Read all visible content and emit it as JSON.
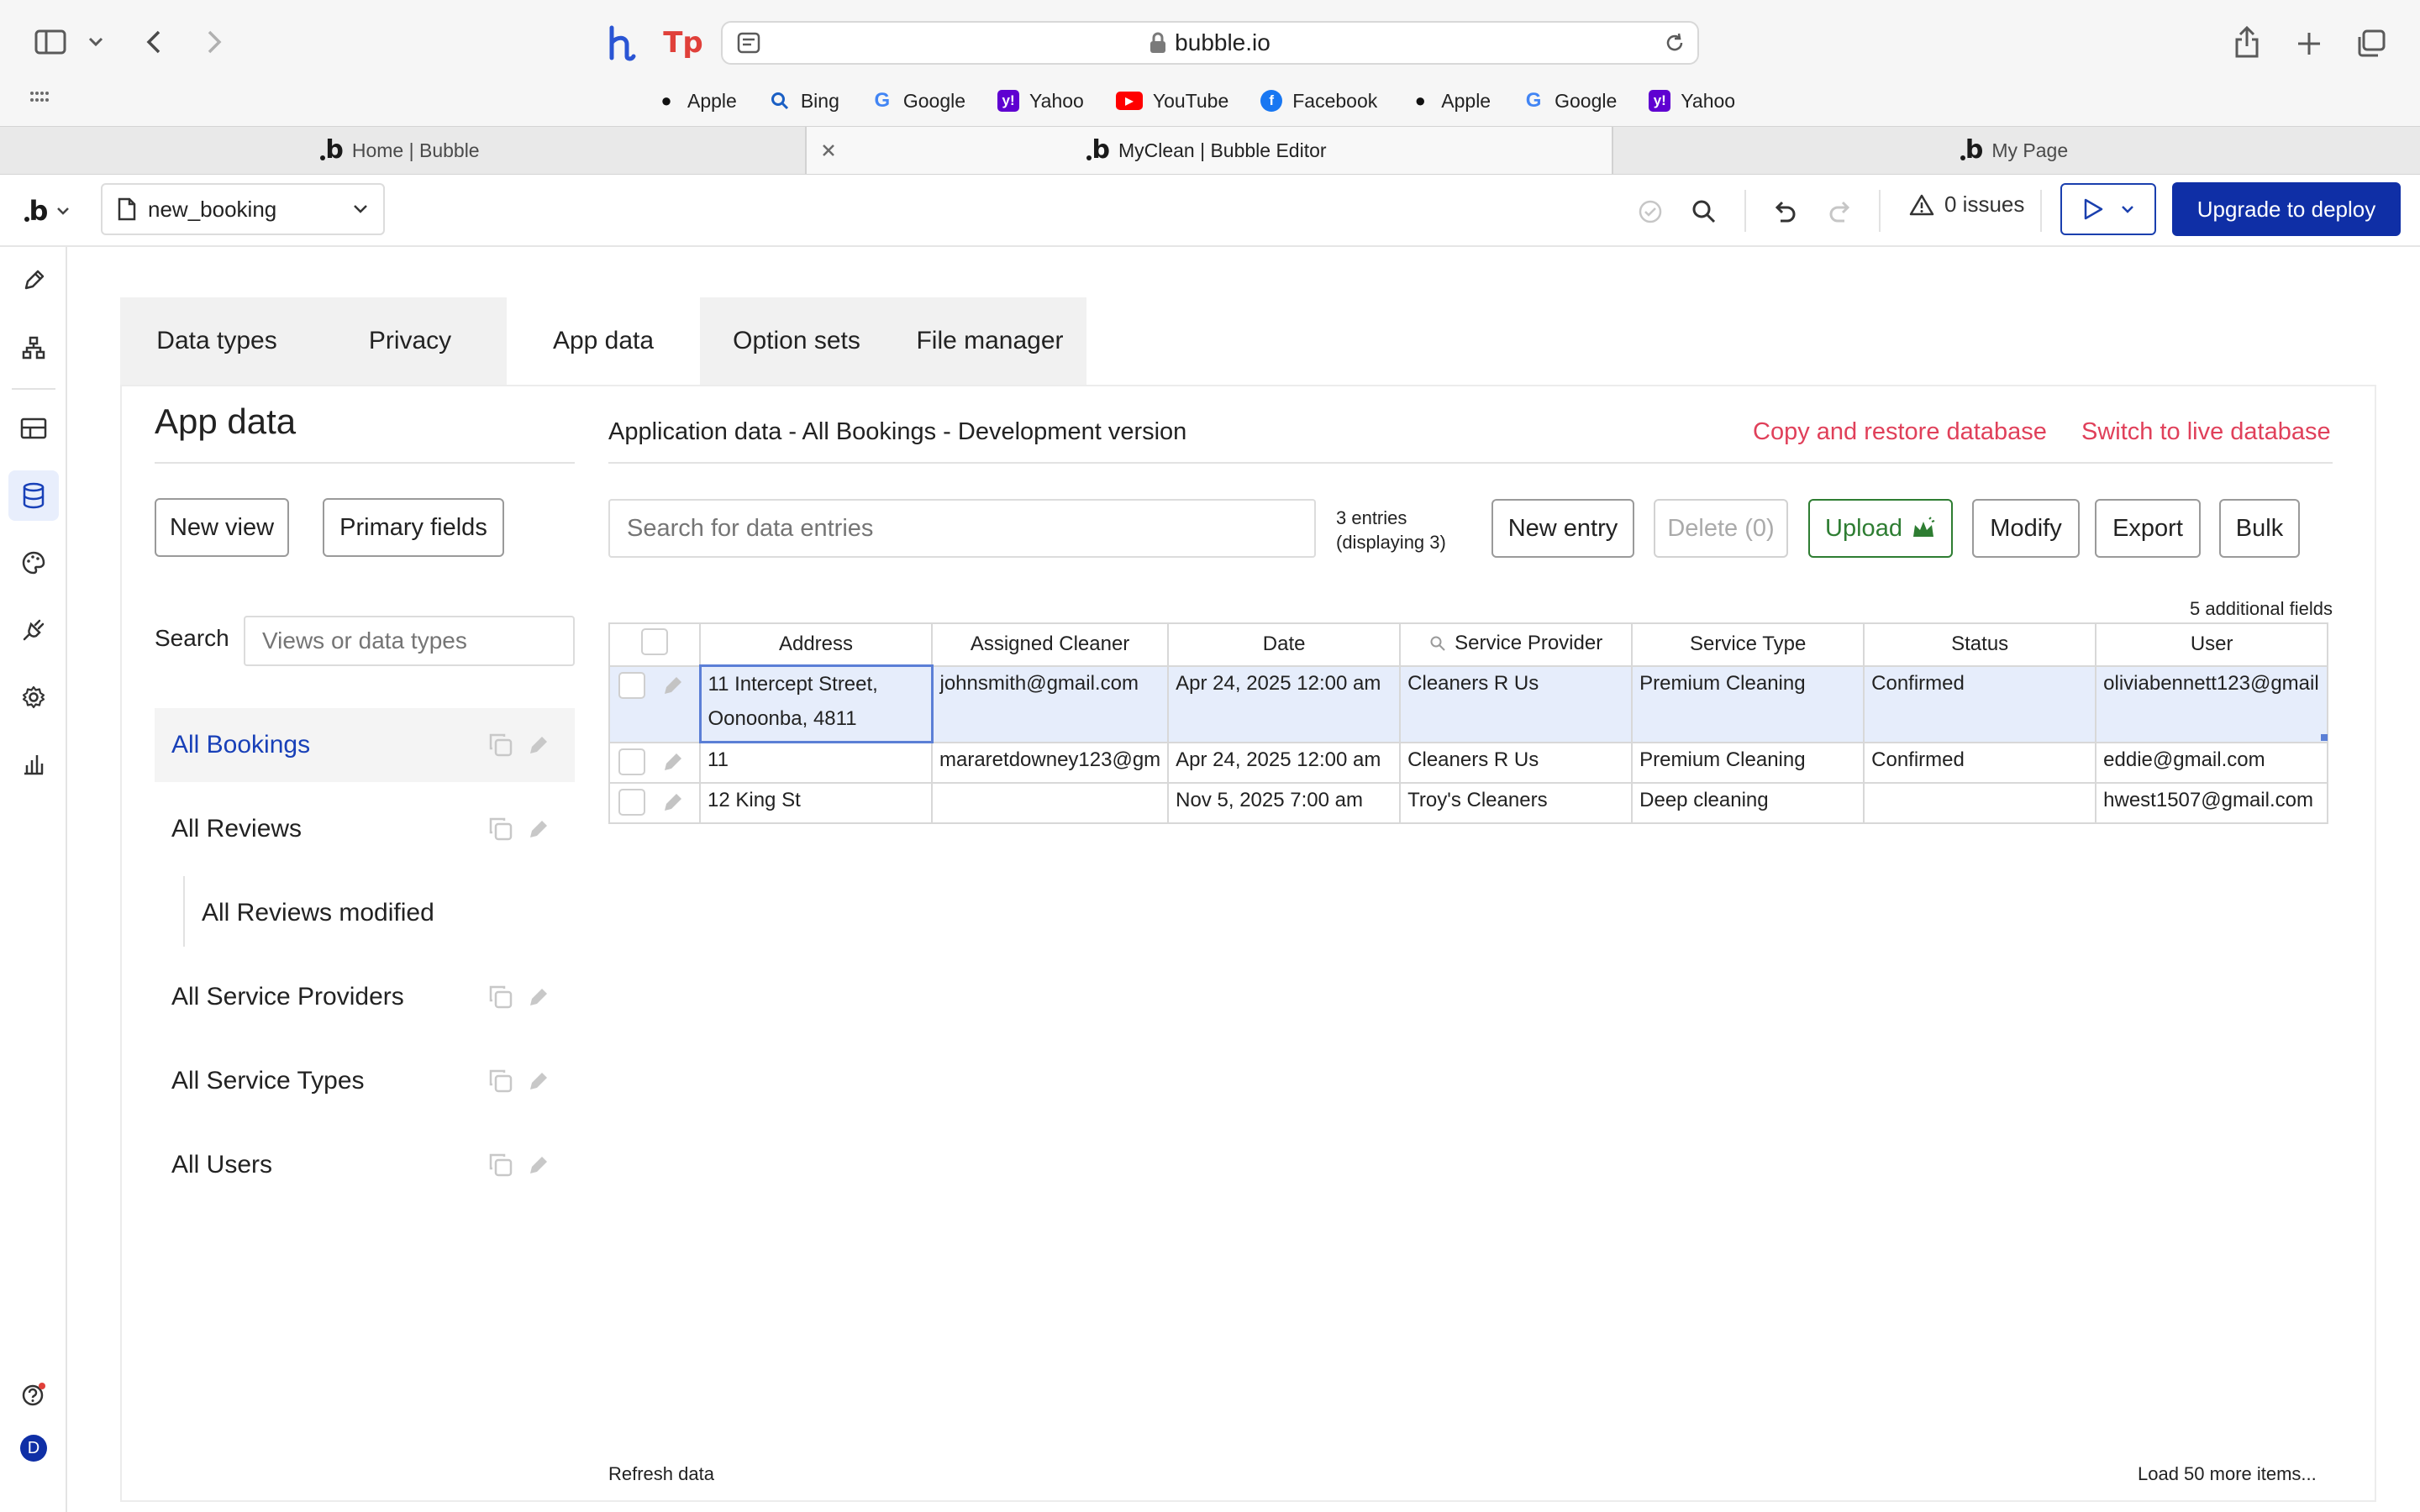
{
  "browser": {
    "url": "bubble.io",
    "bookmarks": [
      {
        "label": "Apple",
        "icon": "apple-icon",
        "color": "#111111"
      },
      {
        "label": "Bing",
        "icon": "bing-search-icon",
        "color": "#1a5fc4"
      },
      {
        "label": "Google",
        "icon": "google-icon",
        "color": "#4285f4"
      },
      {
        "label": "Yahoo",
        "icon": "yahoo-icon",
        "color": "#5f01d1"
      },
      {
        "label": "YouTube",
        "icon": "youtube-icon",
        "color": "#ff0000"
      },
      {
        "label": "Facebook",
        "icon": "facebook-icon",
        "color": "#1877f2"
      },
      {
        "label": "Apple",
        "icon": "apple-icon",
        "color": "#111111"
      },
      {
        "label": "Google",
        "icon": "google-icon",
        "color": "#4285f4"
      },
      {
        "label": "Yahoo",
        "icon": "yahoo-icon",
        "color": "#5f01d1"
      }
    ],
    "tabs": [
      {
        "label": "Home | Bubble",
        "active": false
      },
      {
        "label": "MyClean | Bubble Editor",
        "active": true
      },
      {
        "label": "My Page",
        "active": false
      }
    ]
  },
  "editor": {
    "page_name": "new_booking",
    "issues_label": "0 issues",
    "deploy_label": "Upgrade to deploy",
    "accent_color": "#0f2fa6",
    "avatar_initial": "D"
  },
  "subtabs": [
    "Data types",
    "Privacy",
    "App data",
    "Option sets",
    "File manager"
  ],
  "active_subtab": "App data",
  "sidebar": {
    "title": "App data",
    "new_view_label": "New view",
    "primary_fields_label": "Primary fields",
    "search_label": "Search",
    "search_placeholder": "Views or data types",
    "views": [
      {
        "label": "All Bookings",
        "active": true
      },
      {
        "label": "All Reviews",
        "active": false
      },
      {
        "label": "All Reviews modified",
        "active": false,
        "child": true
      },
      {
        "label": "All Service Providers",
        "active": false
      },
      {
        "label": "All Service Types",
        "active": false
      },
      {
        "label": "All Users",
        "active": false
      }
    ]
  },
  "main": {
    "heading": "Application data - All Bookings - Development version",
    "copy_restore_label": "Copy and restore database",
    "switch_live_label": "Switch to live database",
    "link_color": "#e0405a",
    "search_placeholder": "Search for data entries",
    "entries_line1": "3 entries",
    "entries_line2": "(displaying 3)",
    "buttons": {
      "new_entry": "New entry",
      "delete": "Delete (0)",
      "upload": "Upload",
      "modify": "Modify",
      "export": "Export",
      "bulk": "Bulk"
    },
    "additional_fields": "5 additional fields",
    "columns": [
      "Address",
      "Assigned Cleaner",
      "Date",
      "Service Provider",
      "Service Type",
      "Status",
      "User"
    ],
    "rows": [
      {
        "address": "11 Intercept Street, Oonoonba, 4811",
        "cleaner": "johnsmith@gmail.com",
        "date": "Apr 24, 2025 12:00 am",
        "provider": "Cleaners R Us",
        "service_type": "Premium Cleaning",
        "status": "Confirmed",
        "user": "oliviabennett123@gmail",
        "selected": true
      },
      {
        "address": "11",
        "cleaner": "mararetdowney123@gm",
        "date": "Apr 24, 2025 12:00 am",
        "provider": "Cleaners R Us",
        "service_type": "Premium Cleaning",
        "status": "Confirmed",
        "user": "eddie@gmail.com",
        "selected": false
      },
      {
        "address": "12 King St",
        "cleaner": "",
        "date": "Nov 5, 2025 7:00 am",
        "provider": "Troy's Cleaners",
        "service_type": "Deep cleaning",
        "status": "",
        "user": "hwest1507@gmail.com",
        "selected": false
      }
    ],
    "refresh_label": "Refresh data",
    "load_more_label": "Load 50 more items..."
  }
}
